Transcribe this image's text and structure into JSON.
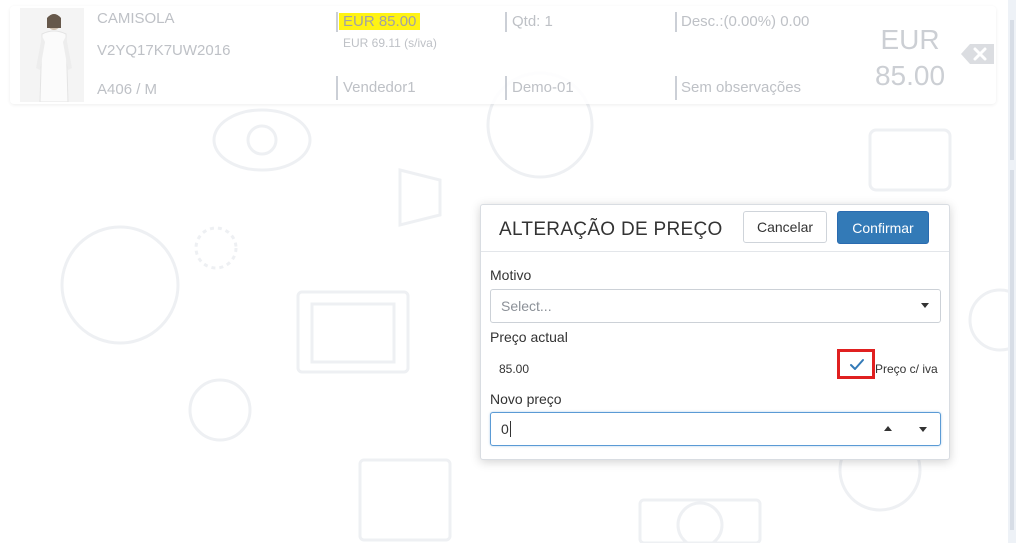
{
  "line": {
    "product_name": "CAMISOLA",
    "product_code": "V2YQ17K7UW2016",
    "size": "A406 / M",
    "price": "EUR 85.00",
    "price_no_vat": "EUR 69.11 (s/iva)",
    "qty": "Qtd: 1",
    "discount": "Desc.:(0.00%) 0.00",
    "seller": "Vendedor1",
    "store": "Demo-01",
    "notes": "Sem observações",
    "total_currency": "EUR",
    "total_value": "85.00"
  },
  "modal": {
    "title": "ALTERAÇÃO DE PREÇO",
    "cancel_label": "Cancelar",
    "confirm_label": "Confirmar",
    "motivo_label": "Motivo",
    "motivo_placeholder": "Select...",
    "current_price_label": "Preço actual",
    "current_price_value": "85.00",
    "vat_checkbox_label": "Preço c/ iva",
    "vat_checked": true,
    "new_price_label": "Novo preço",
    "new_price_value": "0"
  },
  "colors": {
    "confirm_bg": "#337ab7",
    "highlight": "#fff200",
    "annotation_box": "#e02020",
    "check": "#337ab7"
  }
}
